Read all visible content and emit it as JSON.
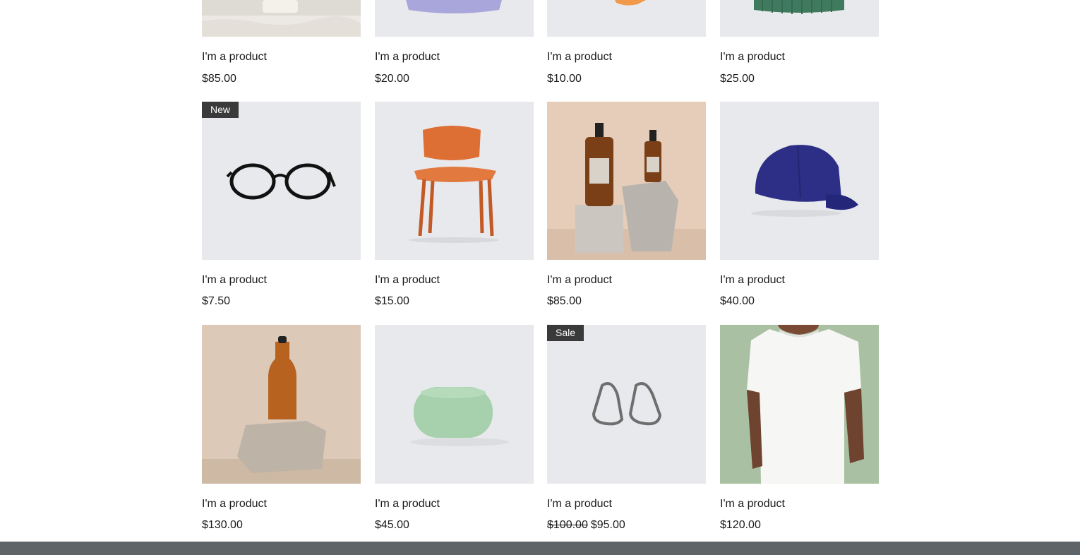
{
  "products": [
    {
      "title": "I'm a product",
      "price": "$85.00",
      "image": "candle-on-stone-image",
      "bg": "#d9d5cf"
    },
    {
      "title": "I'm a product",
      "price": "$20.00",
      "image": "lavender-item-image",
      "bg": "#e8e9ec"
    },
    {
      "title": "I'm a product",
      "price": "$10.00",
      "image": "orange-item-image",
      "bg": "#e8e9ec"
    },
    {
      "title": "I'm a product",
      "price": "$25.00",
      "image": "green-beanie-image",
      "bg": "#e8e9ec"
    },
    {
      "title": "I'm a product",
      "price": "$7.50",
      "ribbon": "New",
      "image": "eyeglasses-image",
      "bg": "#e8e9ec"
    },
    {
      "title": "I'm a product",
      "price": "$15.00",
      "image": "wooden-chair-image",
      "bg": "#e8e9ec"
    },
    {
      "title": "I'm a product",
      "price": "$85.00",
      "image": "amber-bottles-image",
      "bg": "#e2cbb8"
    },
    {
      "title": "I'm a product",
      "price": "$40.00",
      "image": "blue-cap-image",
      "bg": "#e8e9ec"
    },
    {
      "title": "I'm a product",
      "price": "$130.00",
      "image": "copper-water-bottle-image",
      "bg": "#dbc8b6"
    },
    {
      "title": "I'm a product",
      "price": "$45.00",
      "image": "green-soap-bar-image",
      "bg": "#e8e9ec"
    },
    {
      "title": "I'm a product",
      "price": "$95.00",
      "old_price": "$100.00",
      "ribbon": "Sale",
      "image": "silver-earrings-image",
      "bg": "#e8e9ec"
    },
    {
      "title": "I'm a product",
      "price": "$120.00",
      "image": "white-tshirt-image",
      "bg": "#a8bfa1"
    }
  ],
  "colors": {
    "ribbon": "#3a3a3a",
    "footer": "#5f6468",
    "text": "#1a1a1a"
  }
}
